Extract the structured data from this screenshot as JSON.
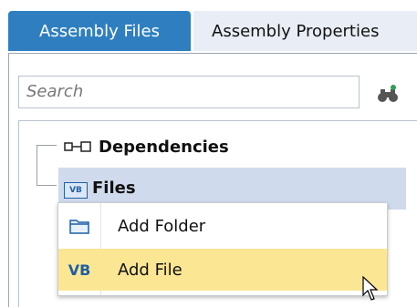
{
  "tabs": {
    "active": "Assembly Files",
    "inactive": "Assembly Properties"
  },
  "search": {
    "placeholder": "Search",
    "filter_icon": "binoculars-filter-icon"
  },
  "tree": {
    "dependencies": {
      "label": "Dependencies",
      "icon": "dependencies-icon"
    },
    "files": {
      "label": "Files",
      "badge": "VB",
      "icon": "vb-file-icon"
    }
  },
  "context_menu": {
    "items": [
      {
        "label": "Add Folder",
        "icon": "folder-icon"
      },
      {
        "label": "Add File",
        "icon_text": "VB",
        "highlighted": true
      }
    ]
  },
  "colors": {
    "tab_active": "#2f7fc0",
    "tab_inactive": "#e9eef6",
    "selected_row": "#cfdaec",
    "menu_highlight": "#fbe694",
    "vb_blue": "#1f5fa5"
  }
}
